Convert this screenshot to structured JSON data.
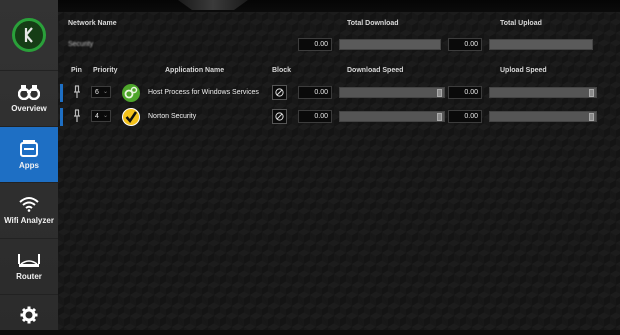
{
  "sidebar": {
    "items": [
      {
        "label": "Overview",
        "icon": "binoculars-icon"
      },
      {
        "label": "Apps",
        "icon": "apps-icon",
        "active": true
      },
      {
        "label": "Wifi Analyzer",
        "icon": "wifi-icon"
      },
      {
        "label": "Router",
        "icon": "router-icon"
      },
      {
        "label": "",
        "icon": "gear-icon"
      }
    ]
  },
  "network": {
    "headers": {
      "name": "Network Name",
      "total_download": "Total Download",
      "total_upload": "Total Upload"
    },
    "name": "Security",
    "total_download": "0.00",
    "total_upload": "0.00"
  },
  "apps": {
    "headers": {
      "pin": "Pin",
      "priority": "Priority",
      "application": "Application Name",
      "block": "Block",
      "download": "Download Speed",
      "upload": "Upload Speed"
    },
    "rows": [
      {
        "priority": "6",
        "name": "Host Process for Windows Services",
        "icon": "gears-icon",
        "download": "0.00",
        "upload": "0.00"
      },
      {
        "priority": "4",
        "name": "Norton Security",
        "icon": "norton-check-icon",
        "download": "0.00",
        "upload": "0.00"
      }
    ]
  },
  "colors": {
    "accent": "#1e6fc4",
    "logo_green": "#2aa03a"
  }
}
